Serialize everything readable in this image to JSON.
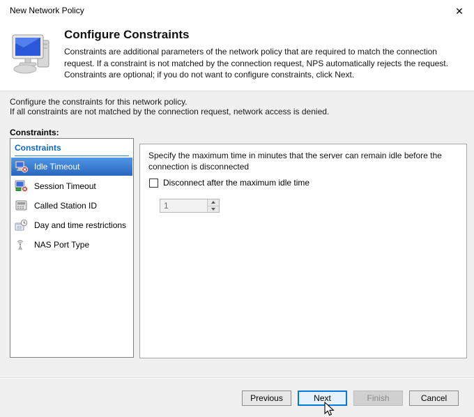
{
  "window": {
    "title": "New Network Policy",
    "close_glyph": "✕"
  },
  "header": {
    "title": "Configure Constraints",
    "description": "Constraints are additional parameters of the network policy that are required to match the connection request. If a constraint is not matched by the connection request, NPS automatically rejects the request. Constraints are optional; if you do not want to configure constraints, click Next."
  },
  "intro": {
    "line1": "Configure the constraints for this network policy.",
    "line2": "If all constraints are not matched by the connection request, network access is denied.",
    "constraints_label": "Constraints:"
  },
  "list": {
    "header": "Constraints",
    "items": [
      {
        "label": "Idle Timeout",
        "icon": "idle-timeout-icon",
        "selected": true
      },
      {
        "label": "Session Timeout",
        "icon": "session-timeout-icon",
        "selected": false
      },
      {
        "label": "Called Station ID",
        "icon": "called-station-id-icon",
        "selected": false
      },
      {
        "label": "Day and time restrictions",
        "icon": "day-time-restrictions-icon",
        "selected": false
      },
      {
        "label": "NAS Port Type",
        "icon": "nas-port-type-icon",
        "selected": false
      }
    ]
  },
  "detail": {
    "instruction": "Specify the maximum time in minutes that the server can remain idle before the connection is disconnected",
    "checkbox_label": "Disconnect after the maximum idle time",
    "checkbox_checked": false,
    "spinner_value": "1",
    "spinner_enabled": false
  },
  "footer": {
    "buttons": [
      {
        "label": "Previous",
        "state": "normal"
      },
      {
        "label": "Next",
        "state": "focused"
      },
      {
        "label": "Finish",
        "state": "disabled"
      },
      {
        "label": "Cancel",
        "state": "normal"
      }
    ]
  },
  "colors": {
    "accent_blue": "#0078d7",
    "selection_gradient_top": "#4f97e3",
    "selection_gradient_bottom": "#2a66c0",
    "list_header_blue": "#1166bb",
    "body_gray": "#f0f0f0",
    "disabled_text": "#8a8a8a"
  }
}
